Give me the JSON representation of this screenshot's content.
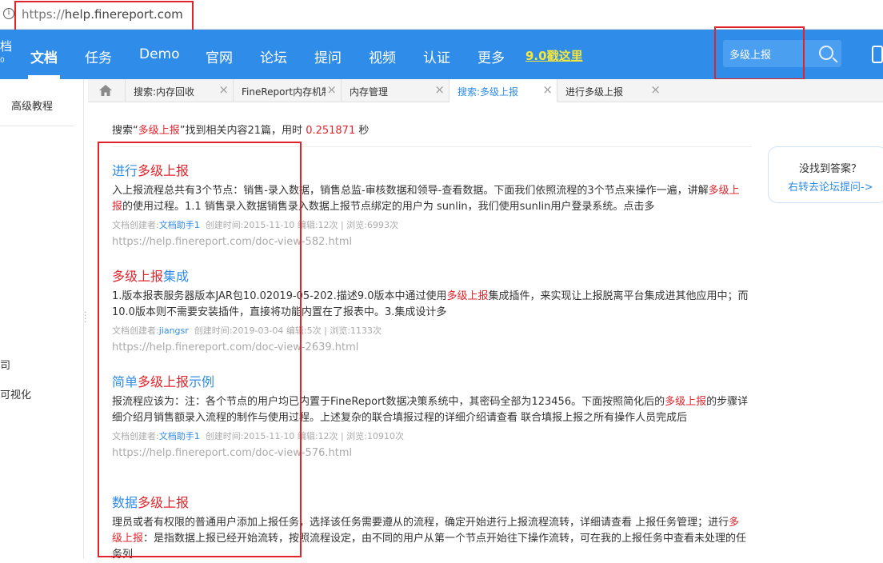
{
  "address_bar": {
    "scheme": "https://",
    "host": "help.finereport.com"
  },
  "nav": {
    "logo_fragment": "档",
    "logo_sub": "0",
    "items": [
      "文档",
      "任务",
      "Demo",
      "官网",
      "论坛",
      "提问",
      "视频",
      "认证",
      "更多"
    ],
    "promo": "9.0戳这里",
    "search_value": "多级上报"
  },
  "sidebar": {
    "advanced": "高级教程",
    "fragment1": "司",
    "fragment2": "可视化"
  },
  "tabs": [
    {
      "label": "搜索:内存回收"
    },
    {
      "label": "FineReport内存机制"
    },
    {
      "label": "内存管理"
    },
    {
      "label": "搜索:多级上报"
    },
    {
      "label": "进行多级上报"
    }
  ],
  "summary": {
    "prefix": "搜索“",
    "keyword": "多级上报",
    "middle": "”找到相关内容21篇，用时",
    "time": "0.251871",
    "suffix": "秒"
  },
  "results": [
    {
      "title_pre": "进行",
      "title_hl": "多级上报",
      "title_post": "",
      "snippet_pre": "入上报流程总共有3个节点：销售-录入数据，销售总监-审核数据和领导-查看数据。下面我们依照流程的3个节点来操作一遍，讲解",
      "snippet_hl": "多级上报",
      "snippet_post": "的使用过程。1.1 销售录入数据销售录入数据上报节点绑定的用户为 sunlin，我们使用sunlin用户登录系统。点击多",
      "meta_prefix": "文档创建者:",
      "author": "文档助手1",
      "meta_rest": "创建时间:2015-11-10 编辑:12次 | 浏览:6993次",
      "url": "https://help.finereport.com/doc-view-582.html"
    },
    {
      "title_pre": "",
      "title_hl": "多级上报",
      "title_post": "集成",
      "snippet_pre": "1.版本报表服务器版本JAR包10.02019-05-202.描述9.0版本中通过使用",
      "snippet_hl": "多级上报",
      "snippet_post": "集成插件，来实现让上报脱离平台集成进其他应用中；而10.0版本则不需要安装插件，直接将功能内置在了报表中。3.集成设计多",
      "meta_prefix": "文档创建者:",
      "author": "jiangsr",
      "meta_rest": "创建时间:2019-03-04 编辑:5次 | 浏览:1133次",
      "url": "https://help.finereport.com/doc-view-2639.html"
    },
    {
      "title_pre": "简单",
      "title_hl": "多级上报",
      "title_post": "示例",
      "snippet_pre": "报流程应该为：注：各个节点的用户均已内置于FineReport数据决策系统中，其密码全部为123456。下面按照简化后的",
      "snippet_hl": "多级上报",
      "snippet_post": "的步骤详细介绍月销售额录入流程的制作与使用过程。上述复杂的联合填报过程的详细介绍请查看 联合填报上报之所有操作人员完成后",
      "meta_prefix": "文档创建者:",
      "author": "文档助手1",
      "meta_rest": "创建时间:2015-11-10 编辑:12次 | 浏览:10910次",
      "url": "https://help.finereport.com/doc-view-576.html"
    },
    {
      "title_pre": "数据",
      "title_hl": "多级上报",
      "title_post": "",
      "snippet_pre": "理员或者有权限的普通用户添加上报任务，选择该任务需要遵从的流程，确定开始进行上报流程流转，详细请查看 上报任务管理；进行",
      "snippet_hl": "多级上报",
      "snippet_post": "：是指数据上报已经开始流转，按照流程设定，由不同的用户从第一个节点开始往下操作流转，可在我的上报任务中查看未处理的任务列",
      "meta_prefix": "",
      "author": "",
      "meta_rest": "",
      "url": ""
    }
  ],
  "help": {
    "question": "没找到答案？",
    "link": "右转去论坛提问->"
  }
}
